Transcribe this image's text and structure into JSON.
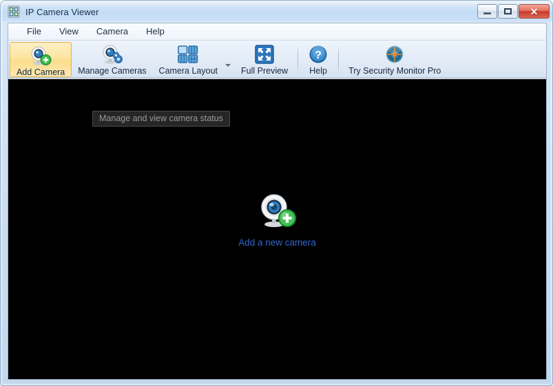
{
  "window": {
    "title": "IP Camera Viewer",
    "app_icon": "camera-grid-icon",
    "buttons": {
      "minimize_label": "–",
      "maximize_label": "□",
      "close_label": "✕"
    }
  },
  "menubar": {
    "items": [
      {
        "label": "File",
        "name": "menu-file"
      },
      {
        "label": "View",
        "name": "menu-view"
      },
      {
        "label": "Camera",
        "name": "menu-camera"
      },
      {
        "label": "Help",
        "name": "menu-help"
      }
    ]
  },
  "toolbar": {
    "buttons": [
      {
        "label": "Add Camera",
        "icon": "camera-add-icon",
        "active": true
      },
      {
        "label": "Manage Cameras",
        "icon": "camera-settings-icon",
        "active": false
      },
      {
        "label": "Camera Layout",
        "icon": "grid-layout-icon",
        "active": false
      },
      {
        "label": "Full Preview",
        "icon": "fullscreen-arrows-icon",
        "active": false
      },
      {
        "label": "Help",
        "icon": "question-mark-icon",
        "active": false
      },
      {
        "label": "Try Security Monitor Pro",
        "icon": "security-target-icon",
        "active": false
      }
    ],
    "dropdown_caret": "chevron-down-icon"
  },
  "viewport": {
    "background_color": "#000000",
    "tooltip": "Manage and view camera status",
    "add_camera_icon": "camera-add-large-icon",
    "add_camera_label": "Add a new camera",
    "link_color": "#2f68cf"
  }
}
